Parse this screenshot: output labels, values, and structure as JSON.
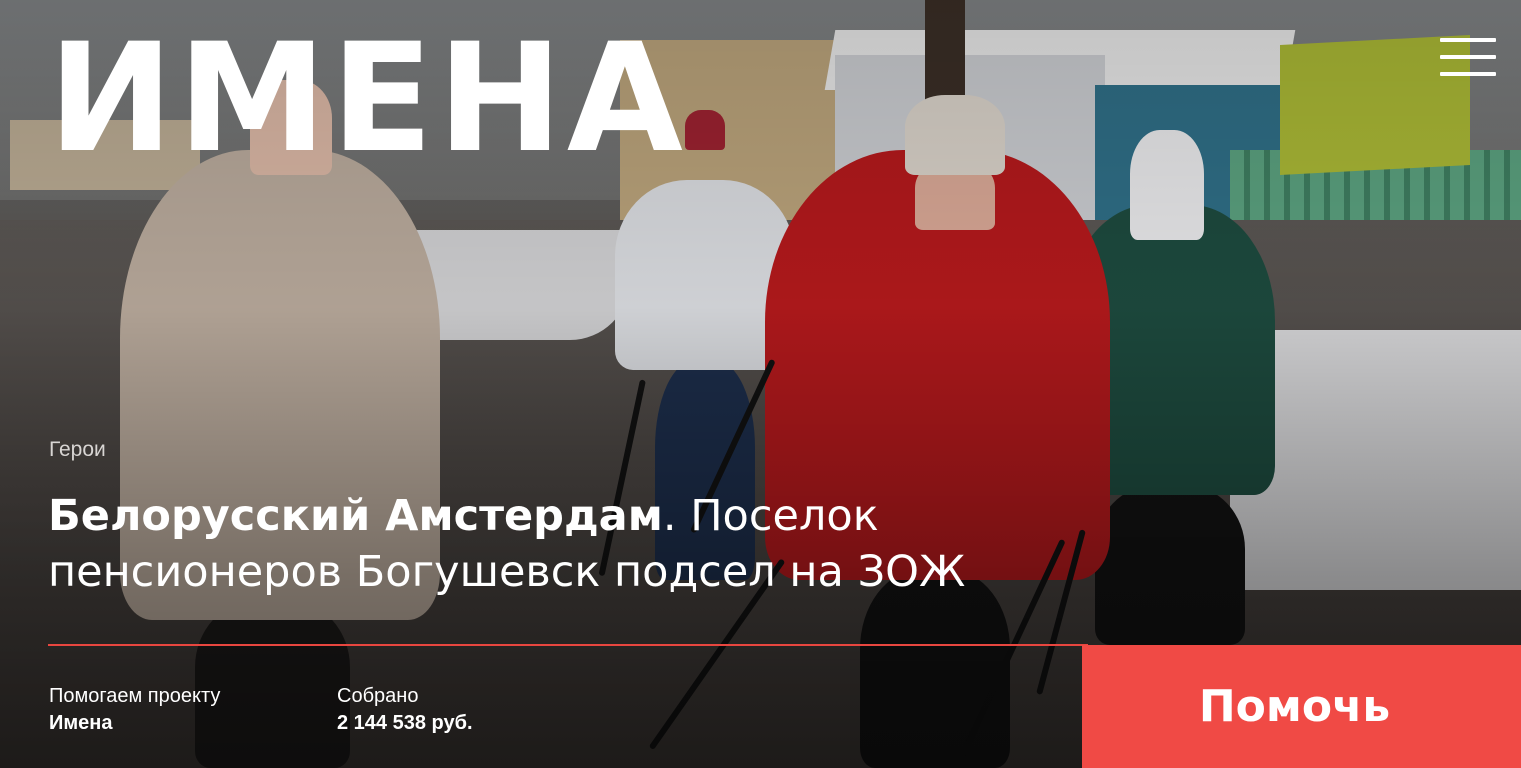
{
  "site": {
    "logo": "ИМЕНА"
  },
  "nav": {
    "menu_icon": "hamburger-menu-icon"
  },
  "article": {
    "category": "Герои",
    "title_bold": "Белорусский Амстердам",
    "title_rest": ". Поселок пенсионеров Богушевск подсел на ЗОЖ"
  },
  "fundraising": {
    "project_label": "Помогаем проекту",
    "project_name": "Имена",
    "raised_label": "Собрано",
    "raised_value": "2 144 538 руб."
  },
  "cta": {
    "help_label": "Помочь"
  },
  "colors": {
    "accent": "#f04a45",
    "divider": "#e8463f",
    "text": "#ffffff"
  }
}
